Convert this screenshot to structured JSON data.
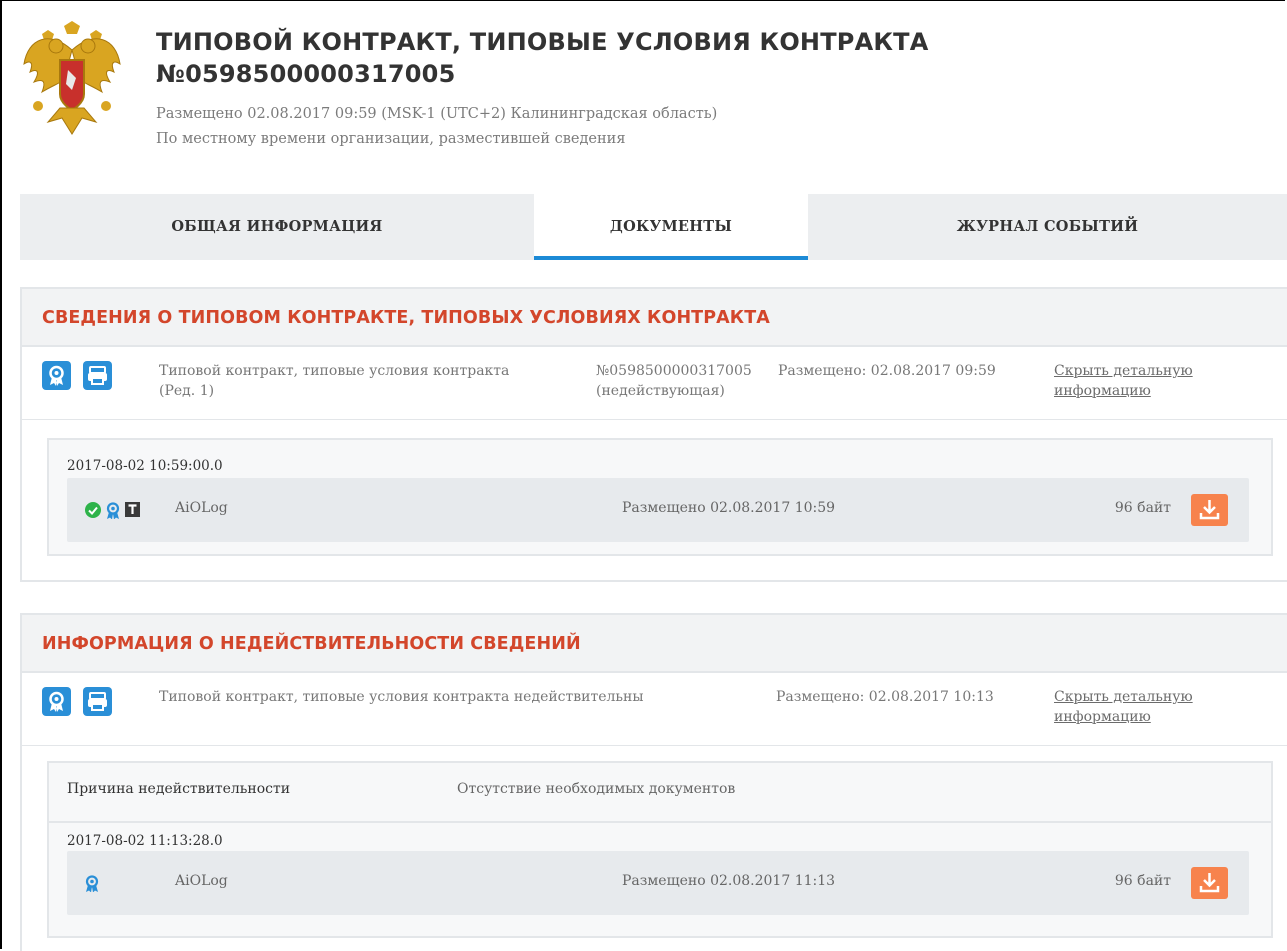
{
  "header": {
    "title_line1": "ТИПОВОЙ КОНТРАКТ, ТИПОВЫЕ УСЛОВИЯ КОНТРАКТА",
    "title_line2": "№0598500000317005",
    "published": "Размещено 02.08.2017 09:59 (MSK-1 (UTC+2) Калининградская область)",
    "local_time_note": "По местному времени организации, разместившей сведения",
    "emblem_icon": "russian-coat-of-arms"
  },
  "tabs": [
    {
      "label": "ОБЩАЯ ИНФОРМАЦИЯ",
      "active": false
    },
    {
      "label": "ДОКУМЕНТЫ",
      "active": true
    },
    {
      "label": "ЖУРНАЛ СОБЫТИЙ",
      "active": false
    }
  ],
  "colors": {
    "accent": "#1c8ad6",
    "section_title": "#d3462b",
    "download": "#f7834d",
    "ok": "#2eb34a"
  },
  "sections": [
    {
      "title": "СВЕДЕНИЯ О ТИПОВОМ КОНТРАКТЕ, ТИПОВЫХ УСЛОВИЯХ КОНТРАКТА",
      "doc": {
        "name_line1": "Типовой контракт, типовые условия контракта",
        "name_line2": "(Ред. 1)",
        "number_line1": "№0598500000317005",
        "number_line2": "(недействующая)",
        "published": "Размещено: 02.08.2017 09:59",
        "toggle_line1": "Скрыть детальную",
        "toggle_line2": "информацию"
      },
      "detail": {
        "timestamp": "2017-08-02 10:59:00.0",
        "file": {
          "name": "AiOLog",
          "published": "Размещено 02.08.2017 10:59",
          "size": "96 байт",
          "icons": [
            "check-icon",
            "certificate-icon",
            "text-icon"
          ]
        }
      }
    },
    {
      "title": "ИНФОРМАЦИЯ О НЕДЕЙСТВИТЕЛЬНОСТИ СВЕДЕНИЙ",
      "doc": {
        "name_line1": "Типовой контракт, типовые условия контракта недействительны",
        "published": "Размещено: 02.08.2017 10:13",
        "toggle_line1": "Скрыть детальную",
        "toggle_line2": "информацию"
      },
      "detail": {
        "reason_label": "Причина недействительности",
        "reason_value": "Отсутствие необходимых документов",
        "timestamp": "2017-08-02 11:13:28.0",
        "file": {
          "name": "AiOLog",
          "published": "Размещено 02.08.2017 11:13",
          "size": "96 байт",
          "icons": [
            "certificate-icon"
          ]
        }
      }
    }
  ]
}
